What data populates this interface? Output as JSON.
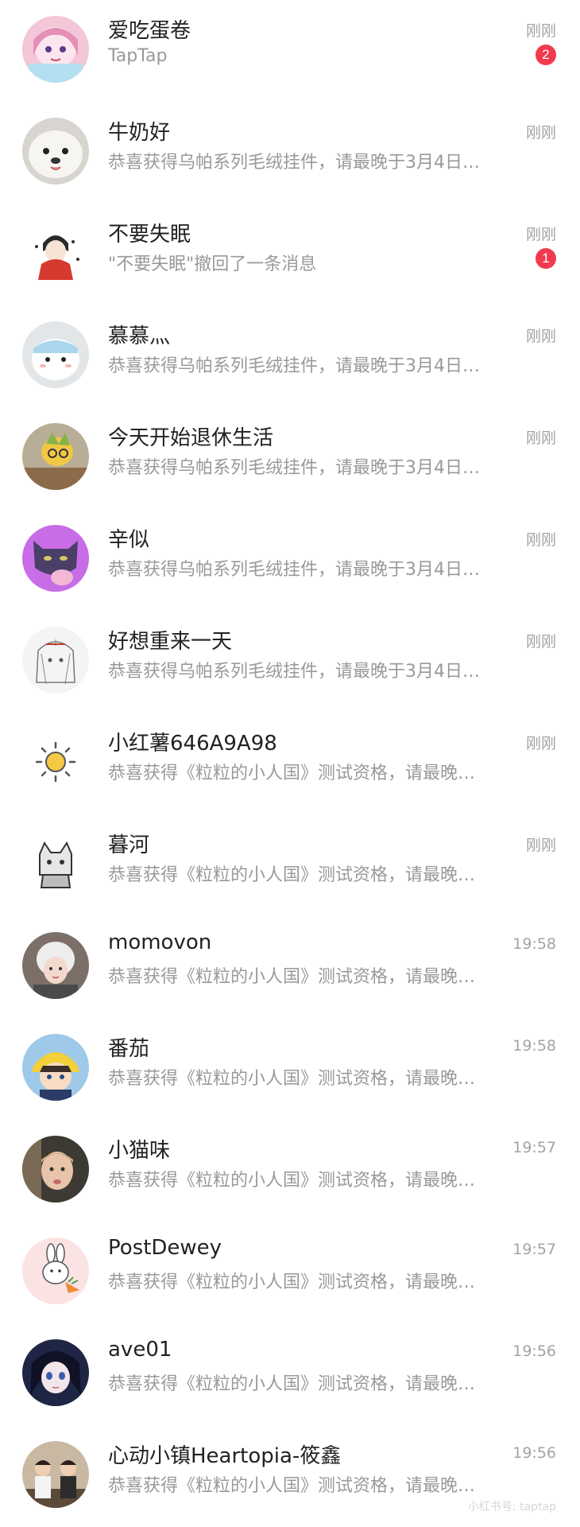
{
  "conversations": [
    {
      "name": "爱吃蛋卷",
      "preview": "TapTap",
      "time": "刚刚",
      "badge": "2"
    },
    {
      "name": "牛奶好",
      "preview": "恭喜获得乌帕系列毛绒挂件，请最晚于3月4日…",
      "time": "刚刚"
    },
    {
      "name": "不要失眠",
      "preview": "\"不要失眠\"撤回了一条消息",
      "time": "刚刚",
      "badge": "1"
    },
    {
      "name": "慕慕灬",
      "preview": "恭喜获得乌帕系列毛绒挂件，请最晚于3月4日…",
      "time": "刚刚"
    },
    {
      "name": "今天开始退休生活",
      "preview": "恭喜获得乌帕系列毛绒挂件，请最晚于3月4日…",
      "time": "刚刚"
    },
    {
      "name": "辛似",
      "preview": "恭喜获得乌帕系列毛绒挂件，请最晚于3月4日…",
      "time": "刚刚"
    },
    {
      "name": "好想重来一天",
      "preview": "恭喜获得乌帕系列毛绒挂件，请最晚于3月4日…",
      "time": "刚刚"
    },
    {
      "name": "小红薯646A9A98",
      "preview": "恭喜获得《粒粒的小人国》测试资格，请最晚…",
      "time": "刚刚"
    },
    {
      "name": "暮河",
      "preview": "恭喜获得《粒粒的小人国》测试资格，请最晚…",
      "time": "刚刚"
    },
    {
      "name": "momovon",
      "preview": "恭喜获得《粒粒的小人国》测试资格，请最晚…",
      "time": "19:58"
    },
    {
      "name": "番茄",
      "preview": "恭喜获得《粒粒的小人国》测试资格，请最晚…",
      "time": "19:58"
    },
    {
      "name": "小猫味",
      "preview": "恭喜获得《粒粒的小人国》测试资格，请最晚…",
      "time": "19:57"
    },
    {
      "name": "PostDewey",
      "preview": "恭喜获得《粒粒的小人国》测试资格，请最晚…",
      "time": "19:57"
    },
    {
      "name": "ave01",
      "preview": "恭喜获得《粒粒的小人国》测试资格，请最晚…",
      "time": "19:56"
    },
    {
      "name": "心动小镇Heartopia-筱鑫",
      "preview": "恭喜获得《粒粒的小人国》测试资格，请最晚…",
      "time": "19:56"
    }
  ],
  "watermark": "小红书号: taptap",
  "colors": {
    "badge": "#f23a4f",
    "name_text": "#222222",
    "preview_text": "#999999",
    "time_text": "#a3a3a3"
  }
}
